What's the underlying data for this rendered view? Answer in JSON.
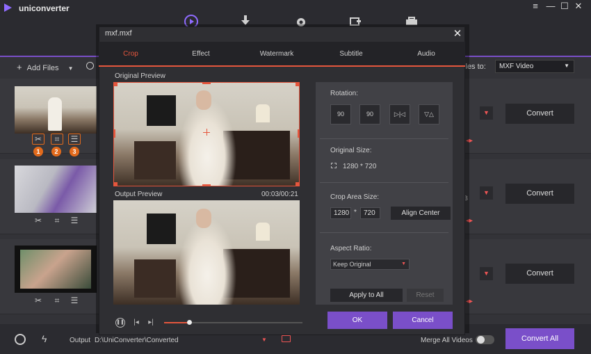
{
  "app": {
    "title": "uniconverter"
  },
  "window_controls": [
    "≡",
    "—",
    "☐",
    "✕"
  ],
  "top_icons": [
    "convert-icon",
    "download-icon",
    "record-icon",
    "transfer-icon",
    "toolbox-icon"
  ],
  "toolbar": {
    "add_files_label": "Add Files",
    "convert_files_to_label": "files to:",
    "format_value": "MXF Video"
  },
  "file_rows": [
    {
      "convert_label": "Convert",
      "badges": [
        "1",
        "2",
        "3"
      ]
    },
    {
      "convert_label": "Convert",
      "partial_text": "B"
    },
    {
      "convert_label": "Convert"
    }
  ],
  "dialog": {
    "title": "mxf.mxf",
    "tabs": [
      "Crop",
      "Effect",
      "Watermark",
      "Subtitle",
      "Audio"
    ],
    "active_tab": "Crop",
    "original_preview_label": "Original Preview",
    "output_preview_label": "Output Preview",
    "time_display": "00:03/00:21",
    "playback_progress": 0.18,
    "rotation_label": "Rotation:",
    "rotation_buttons": [
      "90",
      "90",
      "▷|◁",
      "▽△"
    ],
    "original_size_label": "Original Size:",
    "original_size_value": "1280 * 720",
    "crop_area_label": "Crop Area Size:",
    "crop_width": "1280",
    "crop_sep": "*",
    "crop_height": "720",
    "align_center_label": "Align Center",
    "aspect_ratio_label": "Aspect Ratio:",
    "aspect_ratio_value": "Keep Original",
    "apply_to_all_label": "Apply to All",
    "reset_label": "Reset",
    "ok_label": "OK",
    "cancel_label": "Cancel"
  },
  "bottom": {
    "output_label": "Output",
    "output_path": "D:\\UniConverter\\Converted",
    "merge_label": "Merge All Videos",
    "convert_all_label": "Convert All"
  },
  "colors": {
    "accent": "#7a4fc9",
    "highlight": "#e5563d",
    "badge": "#e26a1c"
  }
}
